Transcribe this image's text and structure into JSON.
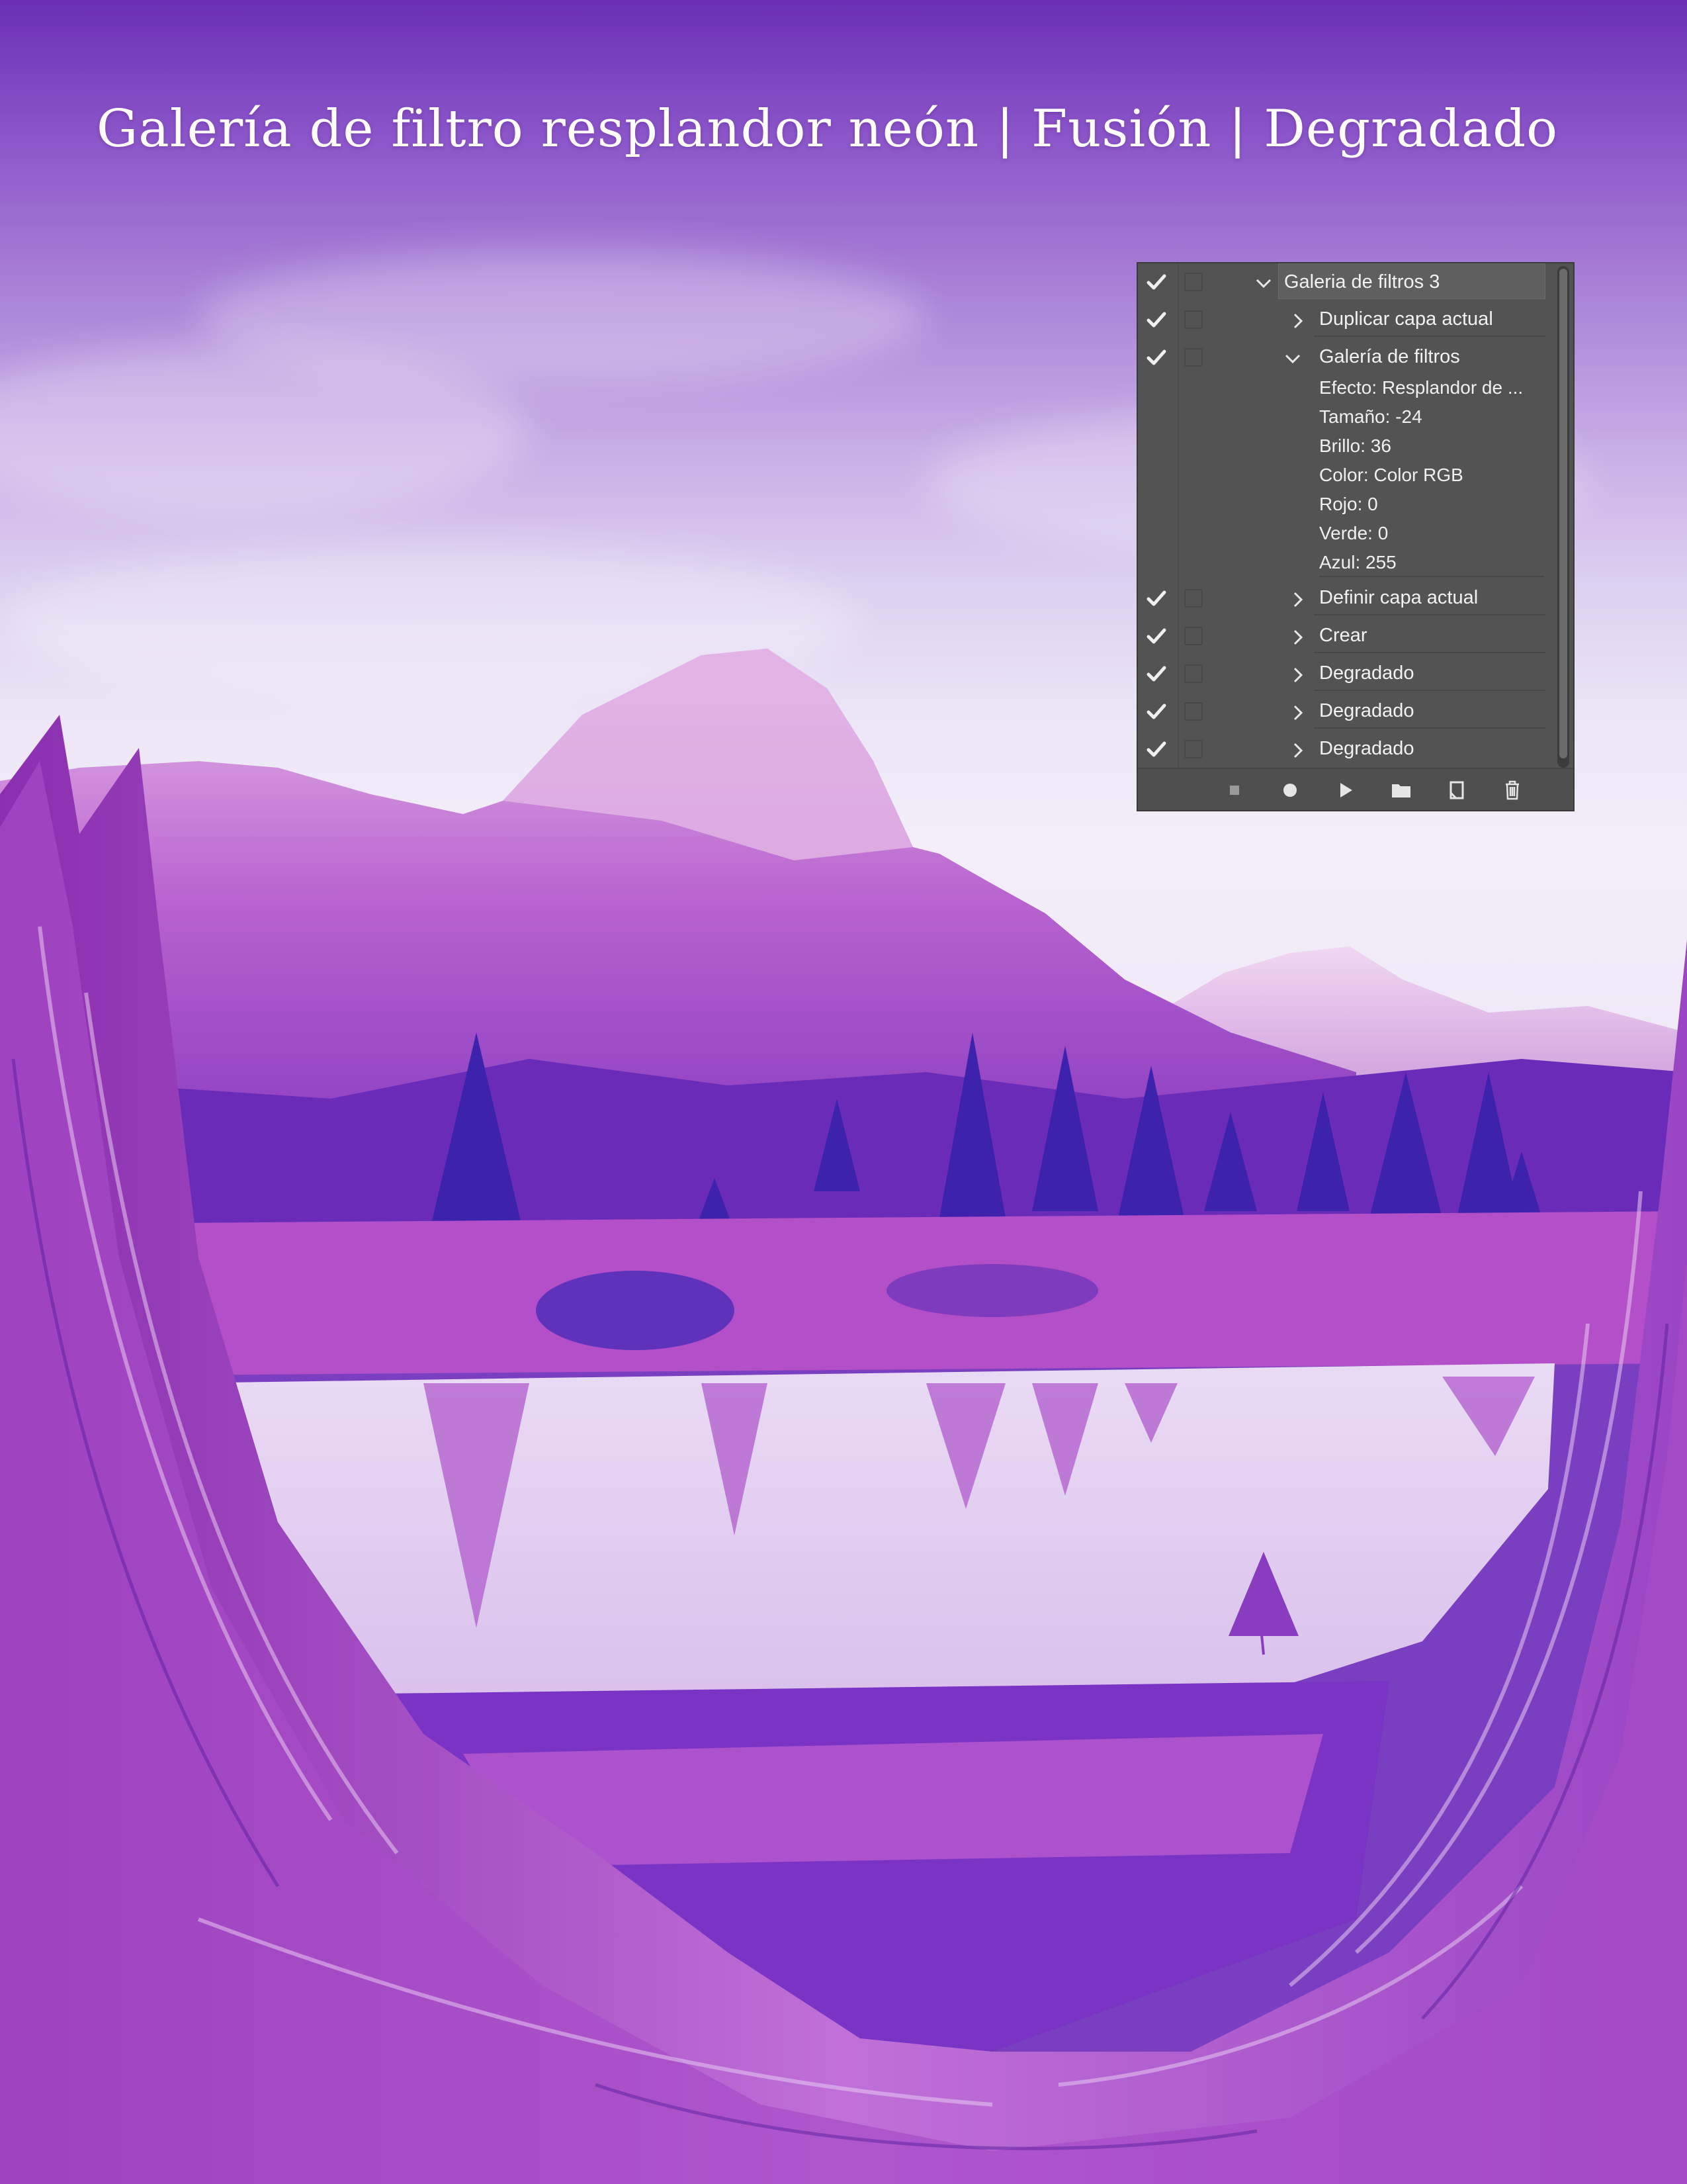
{
  "page": {
    "title": "Galería de filtro resplandor neón | Fusión | Degradado"
  },
  "panel": {
    "rows": [
      {
        "label": "Galeria de filtros 3",
        "checked": true,
        "expanded": true,
        "level": 0
      },
      {
        "label": "Duplicar capa actual",
        "checked": true,
        "expanded": false,
        "level": 1
      },
      {
        "label": "Galería de filtros",
        "checked": true,
        "expanded": true,
        "level": 1
      },
      {
        "label": "Definir capa actual",
        "checked": true,
        "expanded": false,
        "level": 1
      },
      {
        "label": "Crear",
        "checked": true,
        "expanded": false,
        "level": 1
      },
      {
        "label": "Degradado",
        "checked": true,
        "expanded": false,
        "level": 1
      },
      {
        "label": "Degradado",
        "checked": true,
        "expanded": false,
        "level": 1
      },
      {
        "label": "Degradado",
        "checked": true,
        "expanded": false,
        "level": 1
      }
    ],
    "params": [
      "Efecto: Resplandor de ...",
      "Tamaño: -24",
      "Brillo: 36",
      "Color: Color RGB",
      "Rojo: 0",
      "Verde: 0",
      "Azul: 255"
    ],
    "toolbar": [
      "stop-icon",
      "record-icon",
      "play-icon",
      "folder-icon",
      "new-action-icon",
      "trash-icon"
    ]
  },
  "colors": {
    "panel_bg": "#535353",
    "sky_top": "#6a2fb4",
    "mountain": "#c678d8",
    "tree": "#4a25b8",
    "wood": "#a850c8"
  }
}
